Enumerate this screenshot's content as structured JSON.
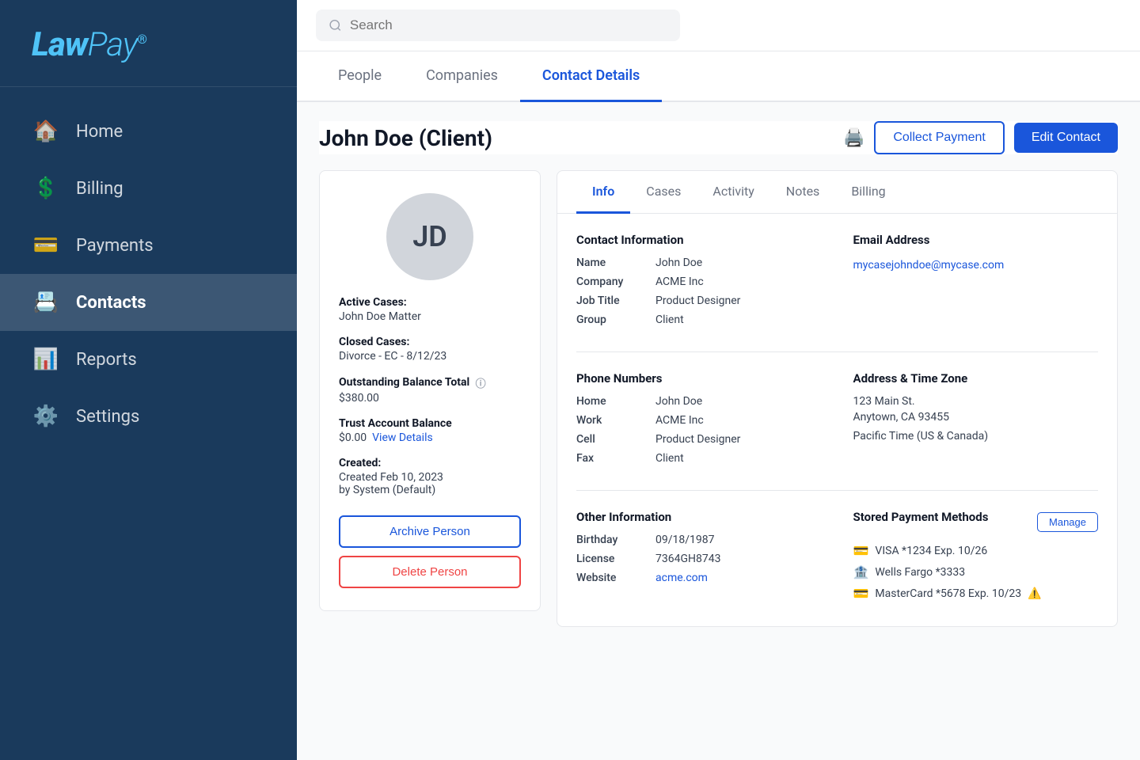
{
  "sidebar": {
    "logo": "LawPay",
    "logo_reg": "®",
    "nav_items": [
      {
        "id": "home",
        "label": "Home",
        "icon": "🏠",
        "active": false
      },
      {
        "id": "billing",
        "label": "Billing",
        "icon": "💲",
        "active": false
      },
      {
        "id": "payments",
        "label": "Payments",
        "icon": "💳",
        "active": false
      },
      {
        "id": "contacts",
        "label": "Contacts",
        "icon": "📇",
        "active": true
      },
      {
        "id": "reports",
        "label": "Reports",
        "icon": "📊",
        "active": false
      },
      {
        "id": "settings",
        "label": "Settings",
        "icon": "⚙️",
        "active": false
      }
    ]
  },
  "search": {
    "placeholder": "Search"
  },
  "tabs": [
    {
      "id": "people",
      "label": "People",
      "active": false
    },
    {
      "id": "companies",
      "label": "Companies",
      "active": false
    },
    {
      "id": "contact-details",
      "label": "Contact Details",
      "active": true
    }
  ],
  "contact": {
    "title": "John Doe (Client)",
    "initials": "JD",
    "buttons": {
      "collect": "Collect Payment",
      "edit": "Edit Contact"
    },
    "left_panel": {
      "active_cases_label": "Active Cases:",
      "active_cases_value": "John Doe Matter",
      "closed_cases_label": "Closed Cases:",
      "closed_cases_value": "Divorce - EC - 8/12/23",
      "outstanding_label": "Outstanding Balance Total",
      "outstanding_value": "$380.00",
      "trust_label": "Trust Account Balance",
      "trust_value": "$0.00",
      "view_details": "View Details",
      "created_label": "Created:",
      "created_value": "Created Feb 10, 2023",
      "created_by": "by System (Default)",
      "archive_button": "Archive Person",
      "delete_button": "Delete Person"
    },
    "detail_tabs": [
      {
        "id": "info",
        "label": "Info",
        "active": true
      },
      {
        "id": "cases",
        "label": "Cases",
        "active": false
      },
      {
        "id": "activity",
        "label": "Activity",
        "active": false
      },
      {
        "id": "notes",
        "label": "Notes",
        "active": false
      },
      {
        "id": "billing",
        "label": "Billing",
        "active": false
      }
    ],
    "contact_info": {
      "section_title": "Contact Information",
      "name_label": "Name",
      "name_value": "John Doe",
      "company_label": "Company",
      "company_value": "ACME Inc",
      "job_title_label": "Job Title",
      "job_title_value": "Product Designer",
      "group_label": "Group",
      "group_value": "Client"
    },
    "email": {
      "section_title": "Email Address",
      "email_value": "mycasejohndoe@mycase.com"
    },
    "phone": {
      "section_title": "Phone Numbers",
      "home_label": "Home",
      "home_value": "John Doe",
      "work_label": "Work",
      "work_value": "ACME Inc",
      "cell_label": "Cell",
      "cell_value": "Product Designer",
      "fax_label": "Fax",
      "fax_value": "Client"
    },
    "address": {
      "section_title": "Address & Time Zone",
      "line1": "123 Main St.",
      "line2": "Anytown, CA 93455",
      "timezone": "Pacific Time (US & Canada)"
    },
    "other_info": {
      "section_title": "Other Information",
      "birthday_label": "Birthday",
      "birthday_value": "09/18/1987",
      "license_label": "License",
      "license_value": "7364GH8743",
      "website_label": "Website",
      "website_value": "acme.com"
    },
    "payment_methods": {
      "section_title": "Stored Payment Methods",
      "manage_label": "Manage",
      "items": [
        {
          "icon": "card",
          "text": "VISA *1234  Exp. 10/26",
          "warning": false
        },
        {
          "icon": "bank",
          "text": "Wells Fargo *3333",
          "warning": false
        },
        {
          "icon": "card",
          "text": "MasterCard *5678  Exp. 10/23",
          "warning": true
        }
      ]
    }
  }
}
